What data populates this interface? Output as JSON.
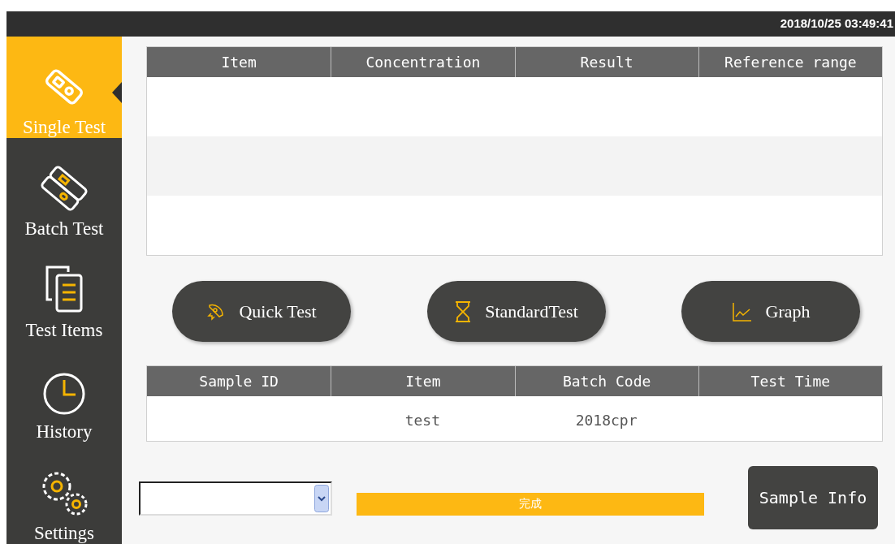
{
  "status_bar": {
    "datetime": "2018/10/25 03:49:41"
  },
  "sidebar": {
    "items": [
      {
        "kind": "single",
        "label": "Single Test",
        "selected": true
      },
      {
        "kind": "batch",
        "label": "Batch Test",
        "selected": false
      },
      {
        "kind": "items",
        "label": "Test Items",
        "selected": false
      },
      {
        "kind": "history",
        "label": "History",
        "selected": false
      },
      {
        "kind": "settings",
        "label": "Settings",
        "selected": false
      }
    ]
  },
  "results_table": {
    "columns": [
      "Item",
      "Concentration",
      "Result",
      "Reference range"
    ]
  },
  "actions": [
    {
      "kind": "quick",
      "label": "Quick Test"
    },
    {
      "kind": "standard",
      "label": "StandardTest"
    },
    {
      "kind": "graph",
      "label": "Graph"
    }
  ],
  "sample_table": {
    "columns": [
      "Sample ID",
      "Item",
      "Batch Code",
      "Test Time"
    ],
    "rows": [
      [
        "",
        "test",
        "2018cpr",
        ""
      ]
    ]
  },
  "progress": {
    "level": 1,
    "label": "完成"
  },
  "sample_info_button": "Sample Info"
}
